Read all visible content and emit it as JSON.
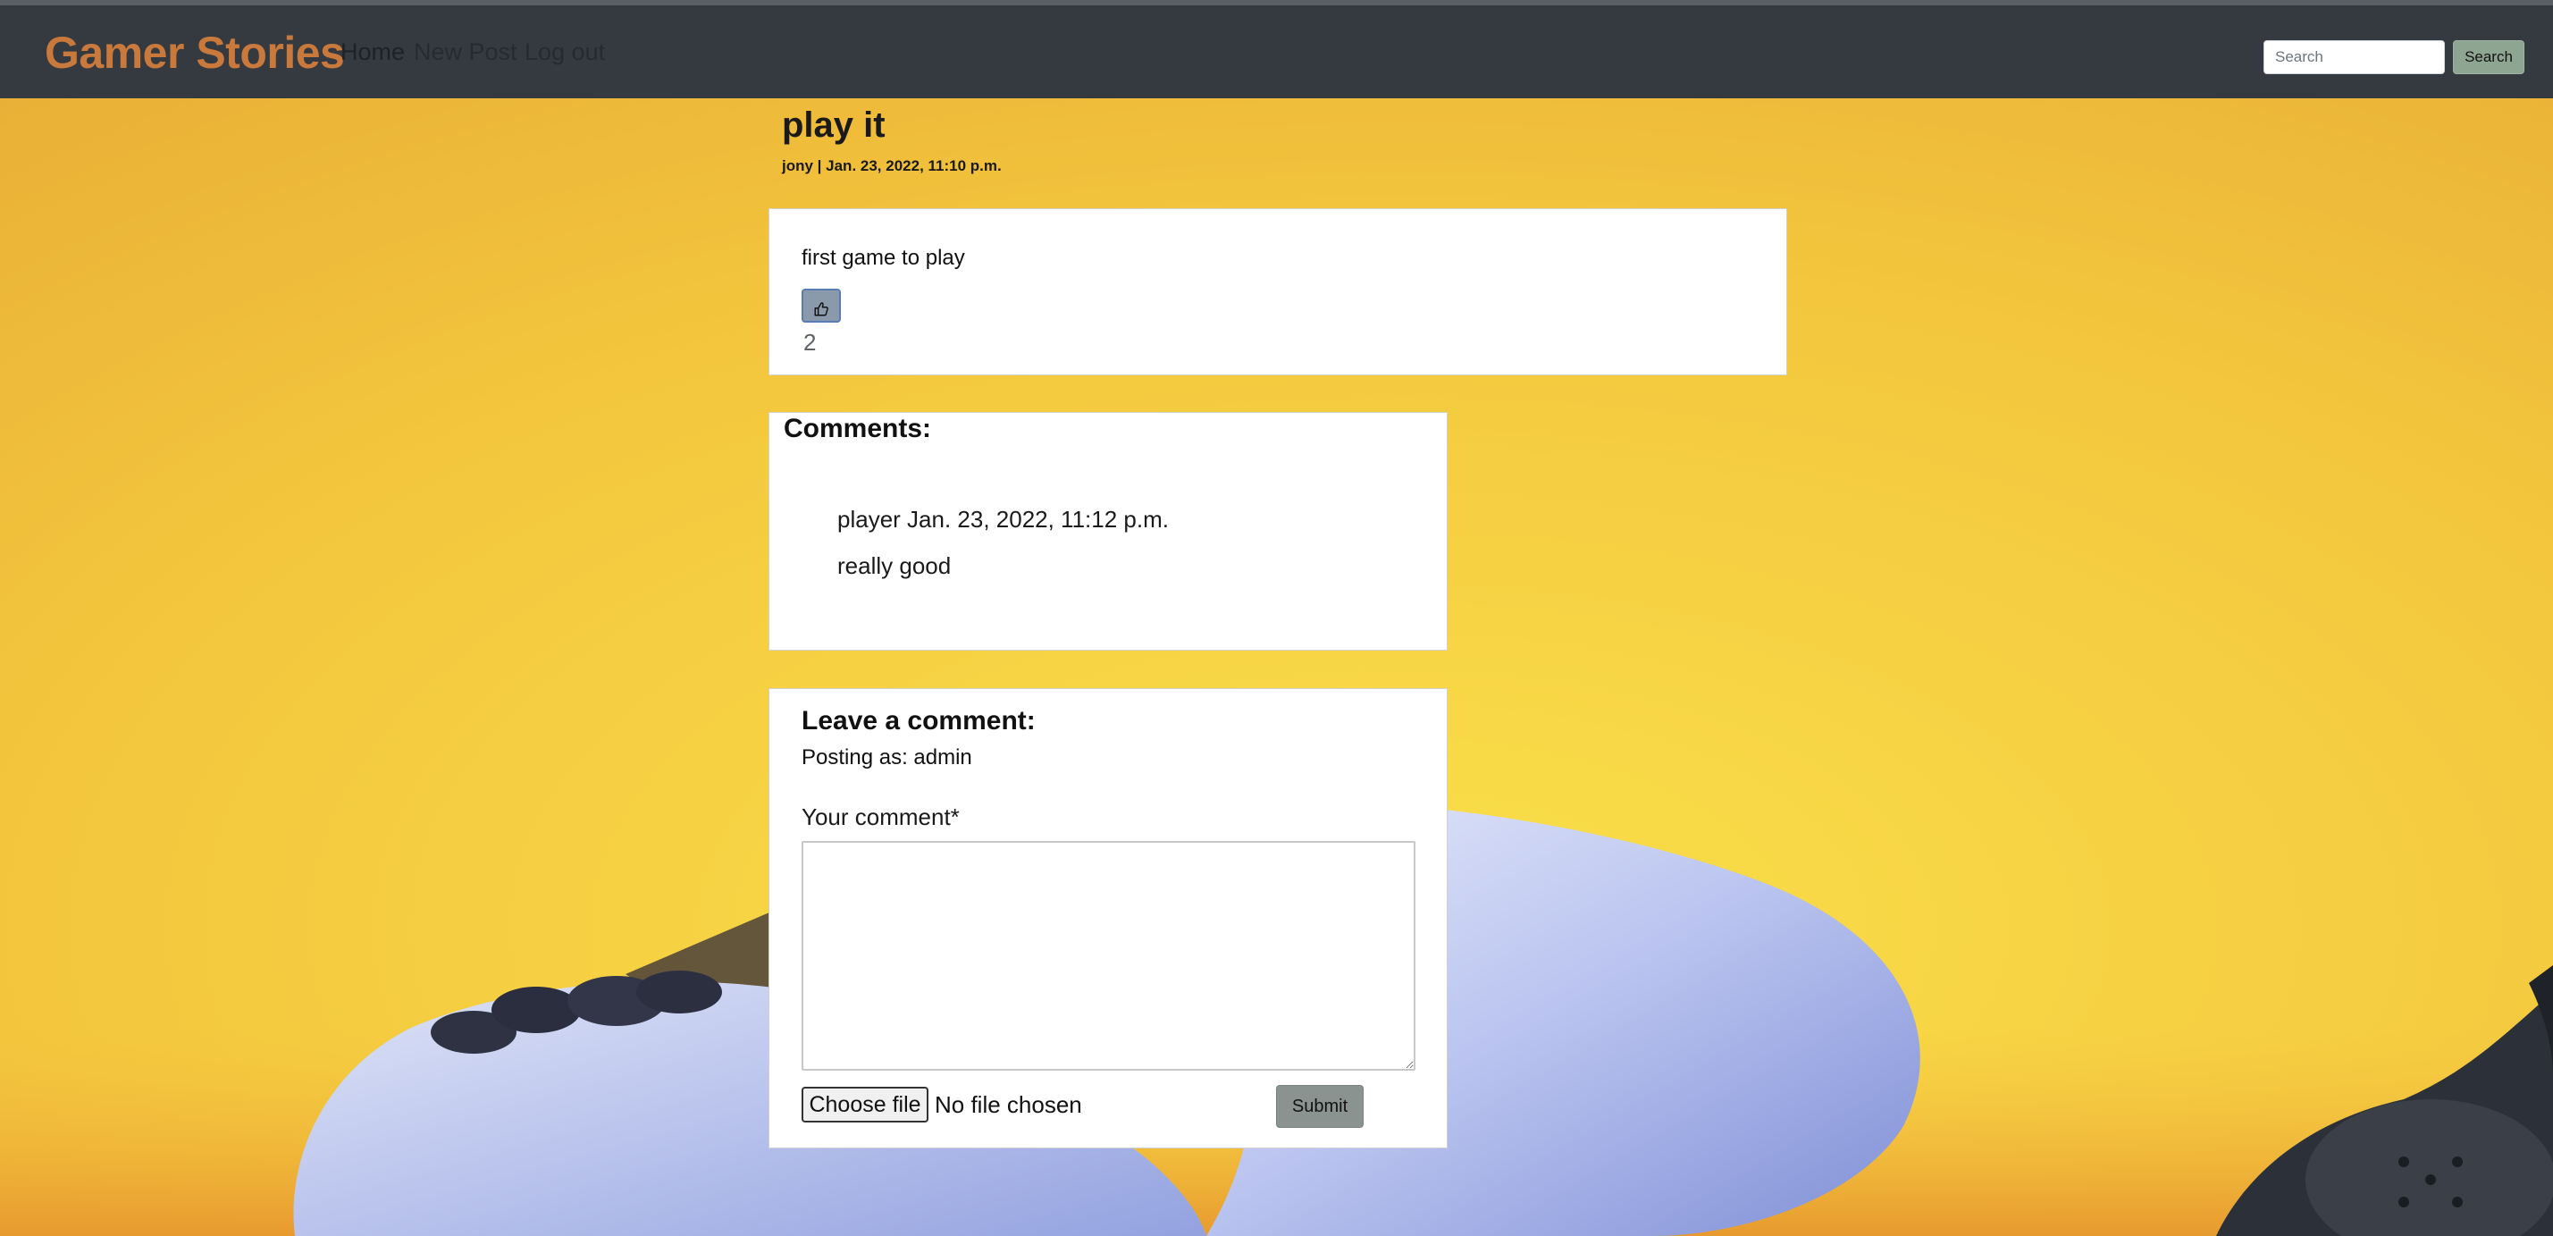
{
  "navbar": {
    "brand": "Gamer Stories",
    "links": [
      "Home",
      "New Post",
      "Log out"
    ],
    "search_placeholder": "Search",
    "search_button": "Search"
  },
  "post": {
    "title": "play it",
    "meta": "jony | Jan. 23, 2022, 11:10 p.m.",
    "content": "first game to play",
    "like_count": "2"
  },
  "comments": {
    "heading": "Comments:",
    "items": [
      {
        "meta": "player Jan. 23, 2022, 11:12 p.m.",
        "body": "really good"
      }
    ]
  },
  "comment_form": {
    "heading": "Leave a comment:",
    "posting_as": "Posting as: admin",
    "label": "Your comment*",
    "file_button": "Choose file",
    "file_status": "No file chosen",
    "submit": "Submit"
  },
  "colors": {
    "navbar_bg": "#343a40",
    "brand": "#c9793b",
    "background": "#f2c640"
  }
}
